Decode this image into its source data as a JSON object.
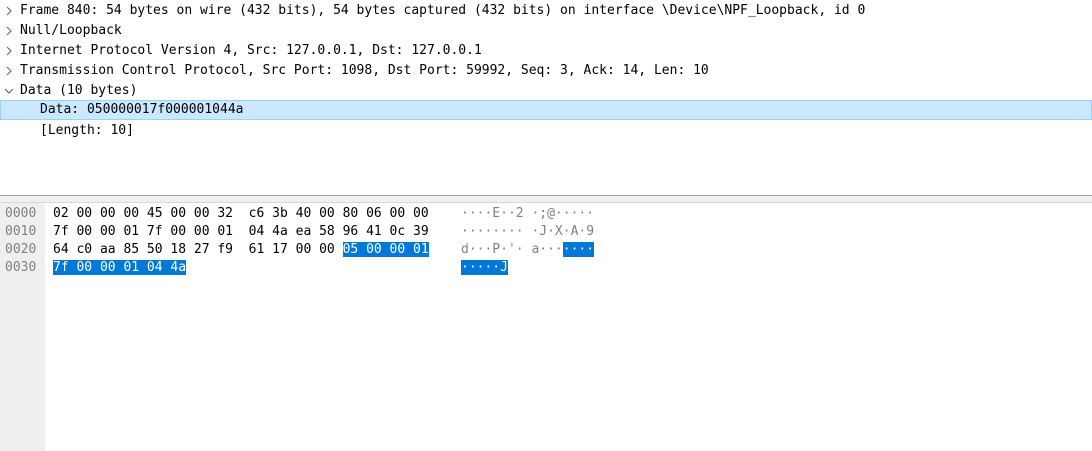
{
  "details": {
    "rows": [
      {
        "text": "Frame 840: 54 bytes on wire (432 bits), 54 bytes captured (432 bits) on interface \\Device\\NPF_Loopback, id 0",
        "expanded": false
      },
      {
        "text": "Null/Loopback",
        "expanded": false
      },
      {
        "text": "Internet Protocol Version 4, Src: 127.0.0.1, Dst: 127.0.0.1",
        "expanded": false
      },
      {
        "text": "Transmission Control Protocol, Src Port: 1098, Dst Port: 59992, Seq: 3, Ack: 14, Len: 10",
        "expanded": false
      },
      {
        "text": "Data (10 bytes)",
        "expanded": true
      }
    ],
    "children": [
      {
        "text": "Data: 050000017f000001044a",
        "selected": true
      },
      {
        "text": "[Length: 10]",
        "selected": false
      }
    ],
    "collapsed_icon": "chevron-right-icon",
    "expanded_icon": "chevron-down-icon"
  },
  "bytes": {
    "rows": [
      {
        "offset": "0000",
        "hex": [
          {
            "text": "02 00 00 00 45 00 00 32  c6 3b 40 00 80 06 00 00",
            "hl": false
          }
        ],
        "ascii": [
          {
            "text": "····E··2 ·;@·····",
            "hl": false
          }
        ]
      },
      {
        "offset": "0010",
        "hex": [
          {
            "text": "7f 00 00 01 7f 00 00 01  04 4a ea 58 96 41 0c 39",
            "hl": false
          }
        ],
        "ascii": [
          {
            "text": "········ ·J·X·A·9",
            "hl": false
          }
        ]
      },
      {
        "offset": "0020",
        "hex": [
          {
            "text": "64 c0 aa 85 50 18 27 f9  61 17 00 00 ",
            "hl": false
          },
          {
            "text": "05 00 00 01",
            "hl": true
          }
        ],
        "ascii": [
          {
            "text": "d···P·'· a···",
            "hl": false
          },
          {
            "text": "····",
            "hl": true
          }
        ]
      },
      {
        "offset": "0030",
        "hex": [
          {
            "text": "7f 00 00 01 04 4a",
            "hl": true
          }
        ],
        "ascii": [
          {
            "text": "·····J",
            "hl": true
          }
        ]
      }
    ]
  },
  "colors": {
    "selection_bg": "#cce8ff",
    "selection_border": "#99d1ff",
    "byte_highlight": "#0078d7",
    "offset_text": "#808080"
  }
}
